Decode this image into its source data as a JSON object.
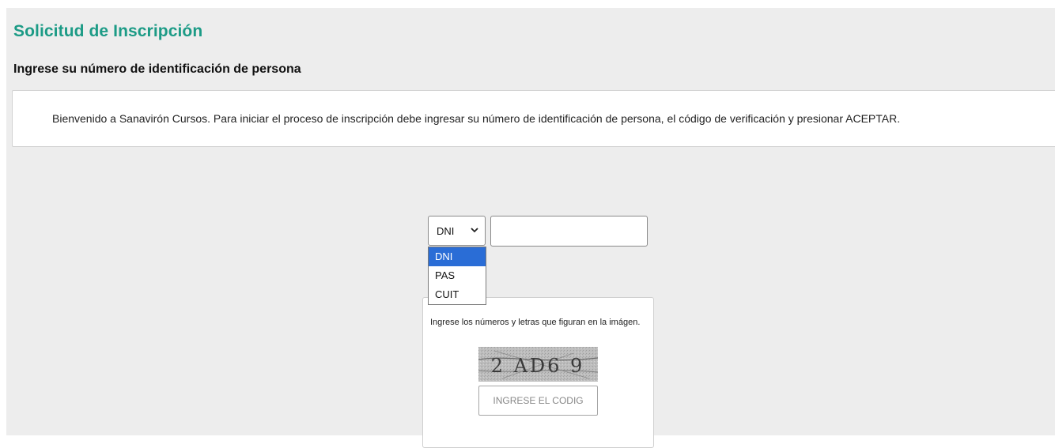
{
  "header": {
    "title": "Solicitud de Inscripción",
    "subtitle": "Ingrese su número de identificación de persona"
  },
  "welcome": {
    "text": "Bienvenido a Sanavirón Cursos. Para iniciar el proceso de inscripción debe ingresar su número de identificación de persona, el código de verificación y presionar ACEPTAR."
  },
  "id_form": {
    "doc_type_selected": "DNI",
    "doc_type_options": [
      "DNI",
      "PAS",
      "CUIT"
    ],
    "doc_number_value": ""
  },
  "captcha": {
    "instruction": "Ingrese los números y letras que figuran en la imágen.",
    "image_text": "2 AD6 9",
    "input_placeholder": "INGRESE EL CODIG"
  },
  "colors": {
    "title_color": "#1c9b86",
    "page_background": "#ededed",
    "dropdown_highlight": "#2a6dd6"
  }
}
